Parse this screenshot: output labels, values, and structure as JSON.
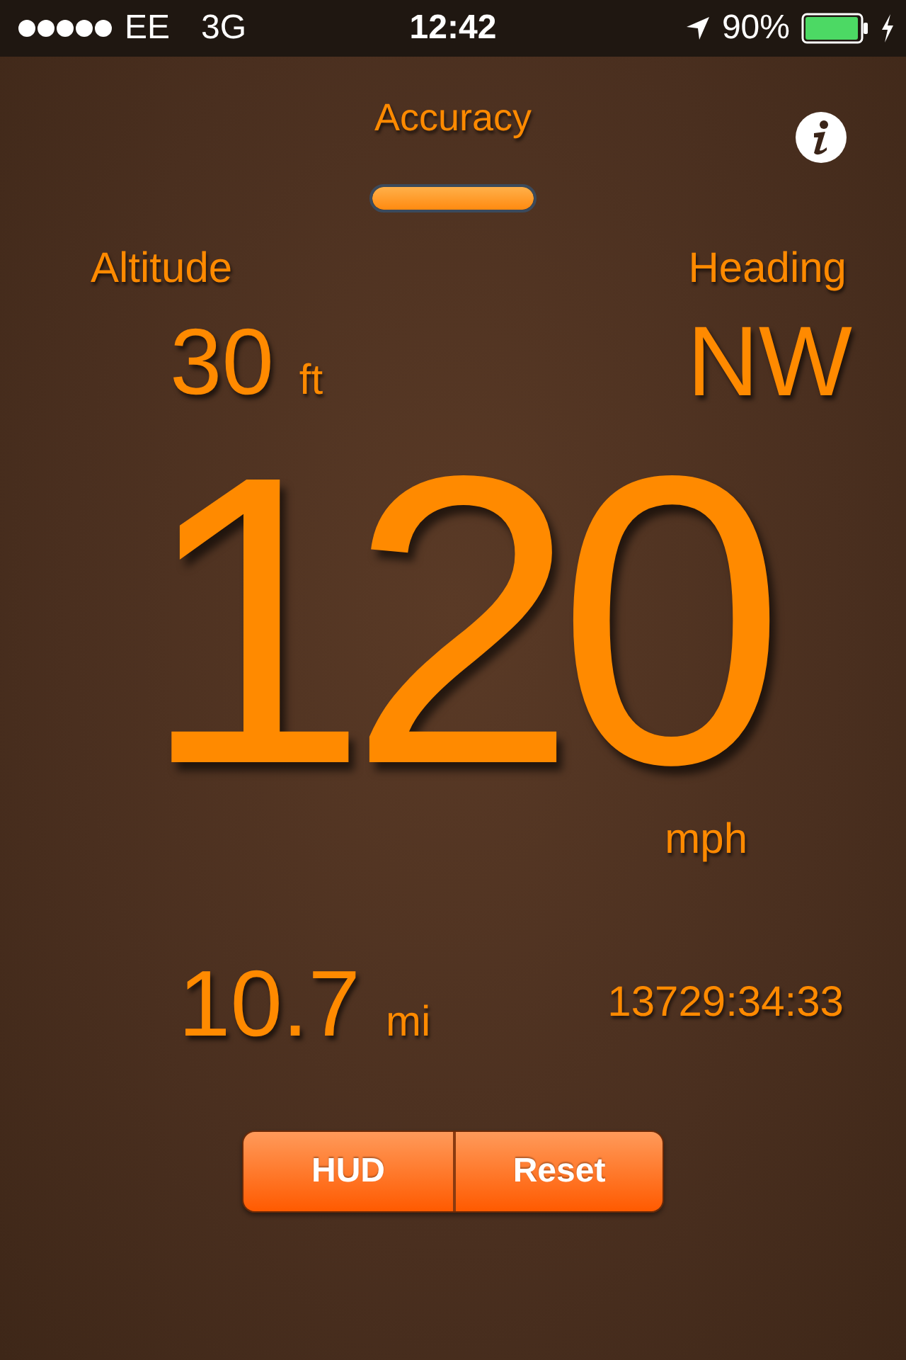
{
  "status_bar": {
    "carrier": "EE",
    "network": "3G",
    "time": "12:42",
    "battery": "90%"
  },
  "accuracy": {
    "label": "Accuracy",
    "level": 1
  },
  "altitude": {
    "label": "Altitude",
    "value": "30",
    "unit": "ft"
  },
  "heading": {
    "label": "Heading",
    "value": "NW"
  },
  "speed": {
    "value": "120",
    "unit": "mph"
  },
  "distance": {
    "value": "10.7",
    "unit": "mi"
  },
  "elapsed": "13729:34:33",
  "buttons": [
    "HUD",
    "Reset"
  ]
}
